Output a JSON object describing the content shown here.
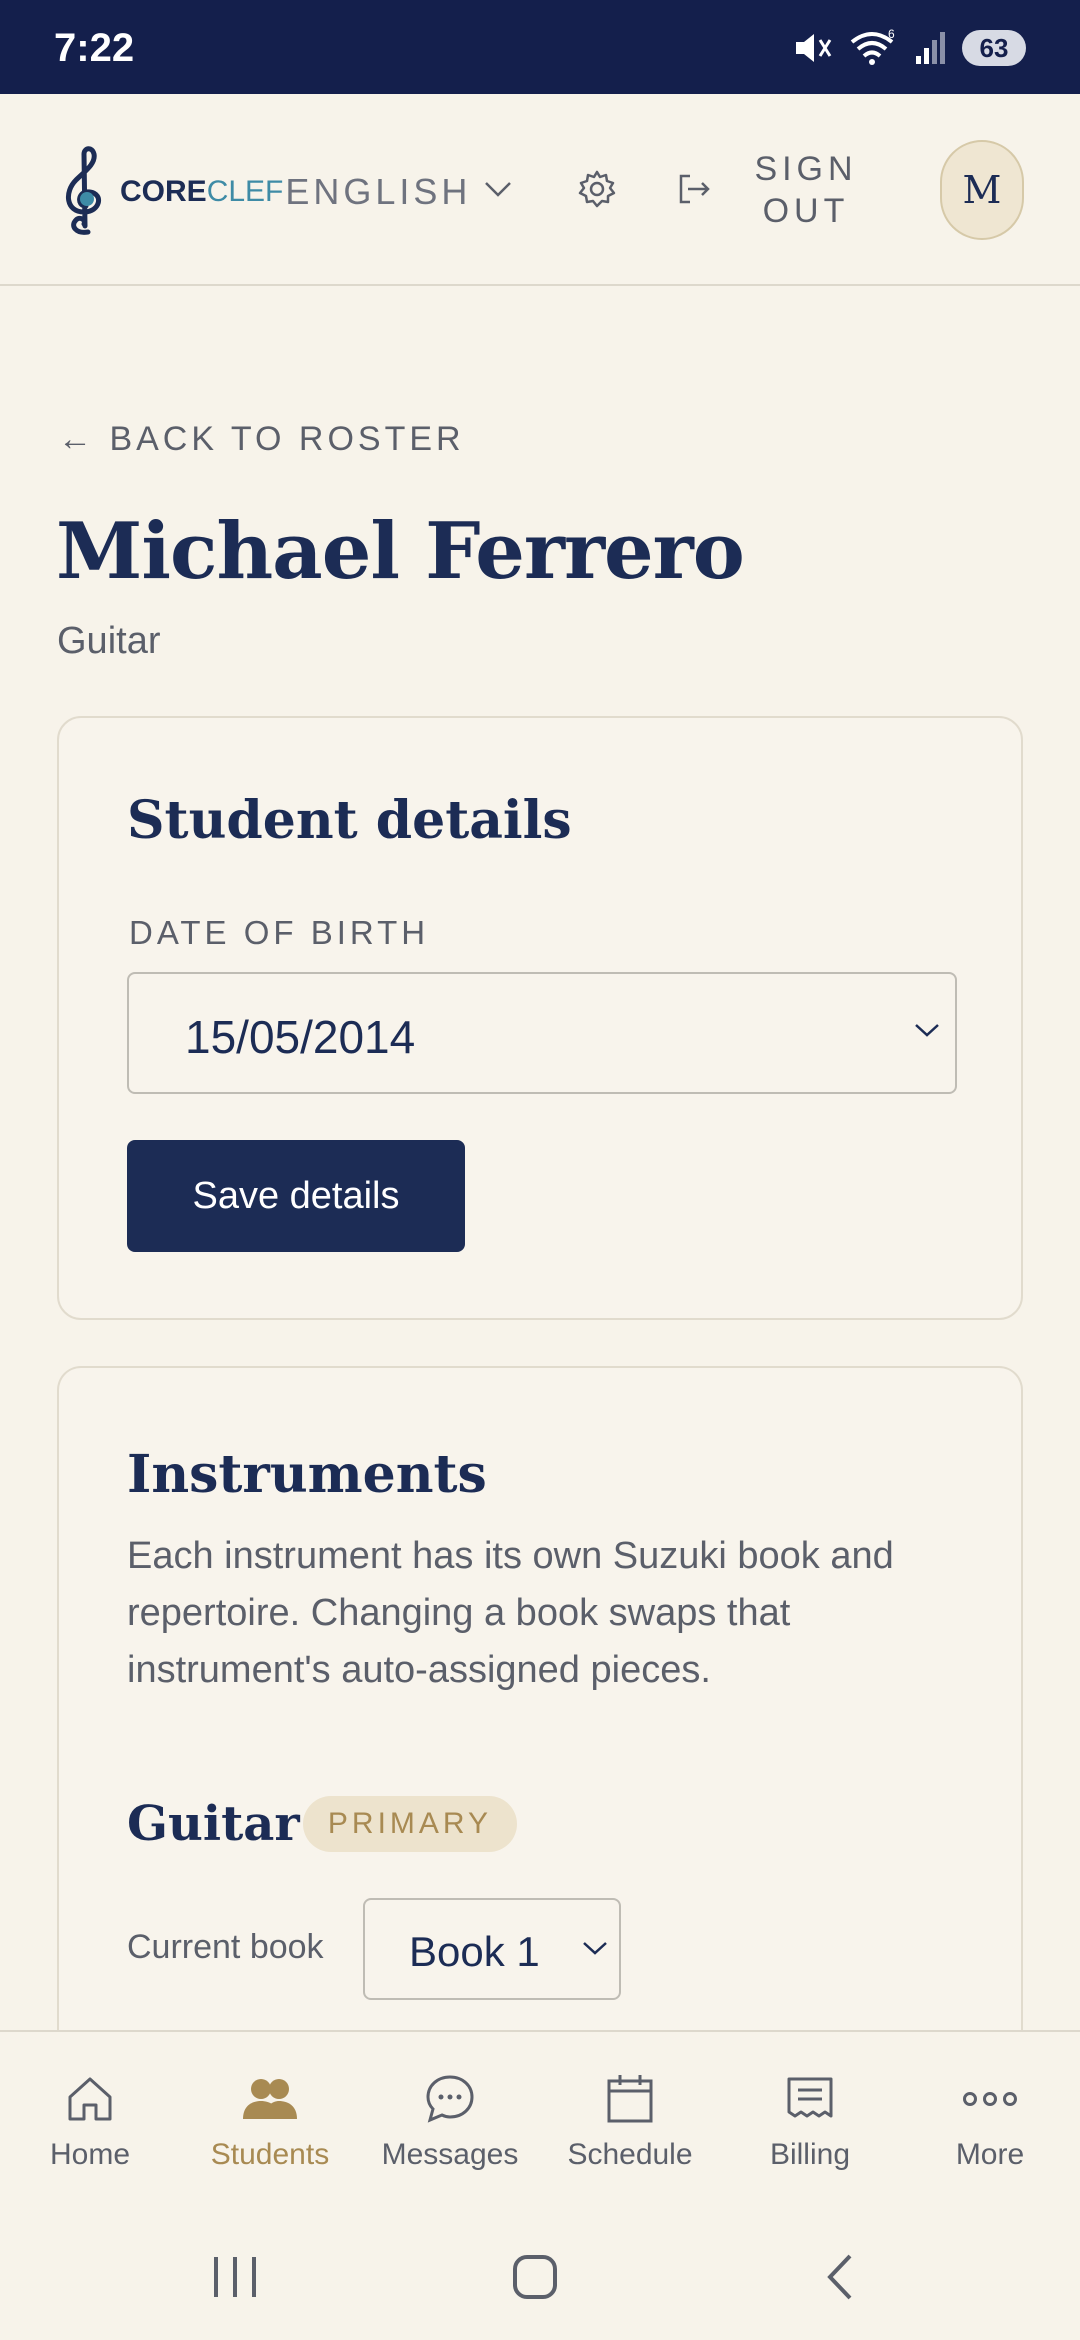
{
  "status_bar": {
    "time": "7:22",
    "battery": "63"
  },
  "header": {
    "logo": {
      "core": "CORE",
      "clef": "CLEF",
      "english": "ENGLISH"
    },
    "sign_out": "SIGN OUT",
    "avatar_initial": "M"
  },
  "page": {
    "back_link": "← BACK TO ROSTER",
    "title": "Michael Ferrero",
    "subtitle": "Guitar"
  },
  "student_details": {
    "title": "Student details",
    "dob_label": "DATE OF BIRTH",
    "dob_value": "15/05/2014",
    "save_label": "Save details"
  },
  "instruments": {
    "title": "Instruments",
    "description": "Each instrument has its own Suzuki book and repertoire. Changing a book swaps that instrument's auto-assigned pieces.",
    "items": [
      {
        "name": "Guitar",
        "badge": "PRIMARY",
        "current_book_label": "Current book",
        "current_book": "Book 1"
      }
    ]
  },
  "bottom_nav": {
    "items": [
      {
        "label": "Home",
        "icon": "home-icon"
      },
      {
        "label": "Students",
        "icon": "students-icon",
        "active": true
      },
      {
        "label": "Messages",
        "icon": "messages-icon"
      },
      {
        "label": "Schedule",
        "icon": "calendar-icon"
      },
      {
        "label": "Billing",
        "icon": "receipt-icon"
      },
      {
        "label": "More",
        "icon": "more-icon"
      }
    ]
  },
  "colors": {
    "navy": "#1c2c55",
    "gold": "#a88a52",
    "background": "#f7f3ea",
    "teal": "#3e8ba6"
  }
}
